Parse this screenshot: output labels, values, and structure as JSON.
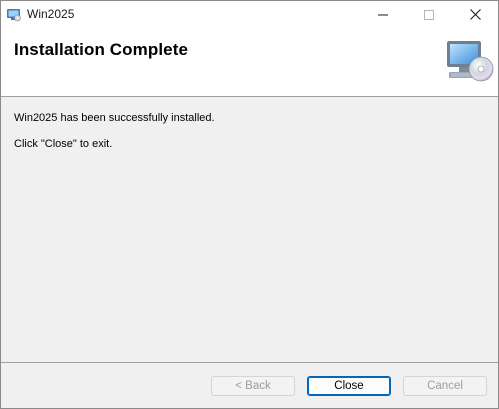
{
  "window": {
    "title": "Win2025",
    "icon": "installer-app-icon",
    "controls": [
      "minimize-icon",
      "maximize-icon",
      "close-icon"
    ]
  },
  "banner": {
    "title": "Installation Complete",
    "graphic": "computer-with-cd-icon"
  },
  "body": {
    "line1": "Win2025 has been successfully installed.",
    "line2": "Click \"Close\" to exit."
  },
  "buttons": {
    "back": "< Back",
    "close": "Close",
    "cancel": "Cancel"
  },
  "colors": {
    "focus_accent": "#0067c0",
    "dialog_background": "#f0f0f0"
  }
}
